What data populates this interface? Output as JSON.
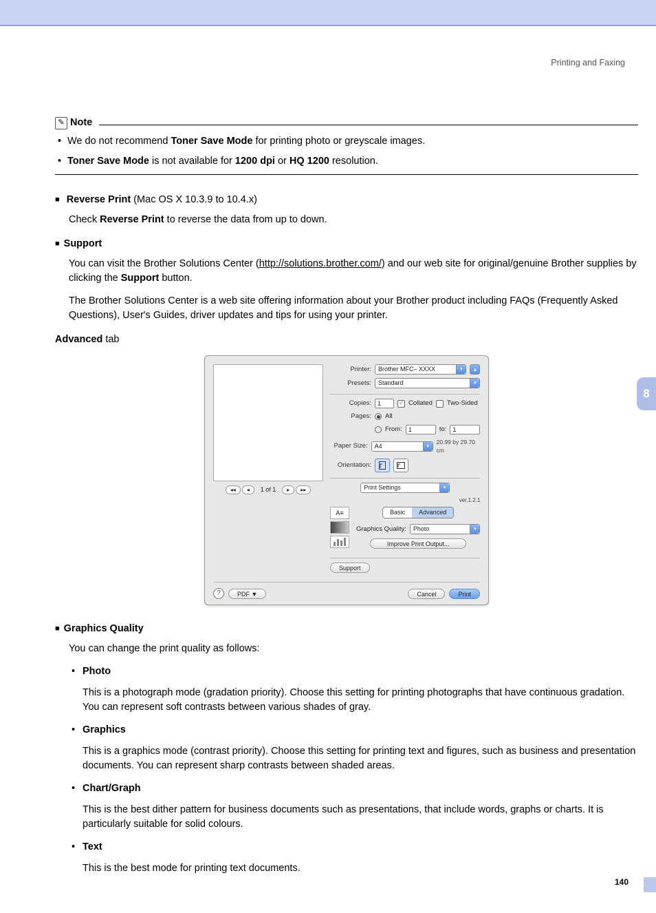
{
  "header": {
    "section_title": "Printing and Faxing"
  },
  "note": {
    "label": "Note",
    "bullet1_pre": "We do not recommend ",
    "bullet1_bold": "Toner Save Mode",
    "bullet1_post": " for printing photo or greyscale images.",
    "bullet2_b1": "Toner Save Mode",
    "bullet2_t1": " is not available for ",
    "bullet2_b2": "1200 dpi",
    "bullet2_t2": " or ",
    "bullet2_b3": "HQ 1200",
    "bullet2_t3": " resolution."
  },
  "reverse_print": {
    "title": "Reverse Print",
    "title_suffix": " (Mac OS X 10.3.9 to 10.4.x)",
    "body_pre": "Check ",
    "body_bold": "Reverse Print",
    "body_post": " to reverse the data from up to down."
  },
  "support": {
    "title": "Support",
    "p1_pre": "You can visit the Brother Solutions Center (",
    "p1_link": "http://solutions.brother.com/",
    "p1_mid": ") and our web site for original/genuine Brother supplies by clicking the ",
    "p1_bold": "Support",
    "p1_post": " button.",
    "p2": "The Brother Solutions Center is a web site offering information about your Brother product including FAQs (Frequently Asked Questions), User's Guides, driver updates and tips for using your printer."
  },
  "advanced_tab": {
    "label_bold": "Advanced",
    "label_rest": " tab"
  },
  "dialog": {
    "printer_label": "Printer:",
    "printer_value": "Brother MFC– XXXX",
    "presets_label": "Presets:",
    "presets_value": "Standard",
    "copies_label": "Copies:",
    "copies_value": "1",
    "collated_label": "Collated",
    "two_sided_label": "Two-Sided",
    "pages_label": "Pages:",
    "pages_all": "All",
    "pages_from": "From:",
    "pages_from_value": "1",
    "pages_to": "to:",
    "pages_to_value": "1",
    "paper_size_label": "Paper Size:",
    "paper_size_value": "A4",
    "paper_dims": "20.99 by 29.70 cm",
    "orientation_label": "Orientation:",
    "section_select": "Print Settings",
    "version": "ver.1.2.1",
    "tab_basic": "Basic",
    "tab_advanced": "Advanced",
    "gq_label": "Graphics Quality:",
    "gq_value": "Photo",
    "improve_btn": "Improve Print Output...",
    "support_btn": "Support",
    "preview_page": "1 of 1",
    "pdf_btn": "PDF ▼",
    "cancel_btn": "Cancel",
    "print_btn": "Print"
  },
  "graphics_quality": {
    "title": "Graphics Quality",
    "intro": "You can change the print quality as follows:",
    "items": [
      {
        "name": "Photo",
        "desc": "This is a photograph mode (gradation priority). Choose this setting for printing photographs that have continuous gradation. You can represent soft contrasts between various shades of gray."
      },
      {
        "name": "Graphics",
        "desc": "This is a graphics mode (contrast priority). Choose this setting for printing text and figures, such as business and presentation documents. You can represent sharp contrasts between shaded areas."
      },
      {
        "name": "Chart/Graph",
        "desc": "This is the best dither pattern for business documents such as presentations, that include words, graphs or charts. It is particularly suitable for solid colours."
      },
      {
        "name": "Text",
        "desc": "This is the best mode for printing text documents."
      }
    ]
  },
  "page_number": "140",
  "chapter_tab": "8"
}
